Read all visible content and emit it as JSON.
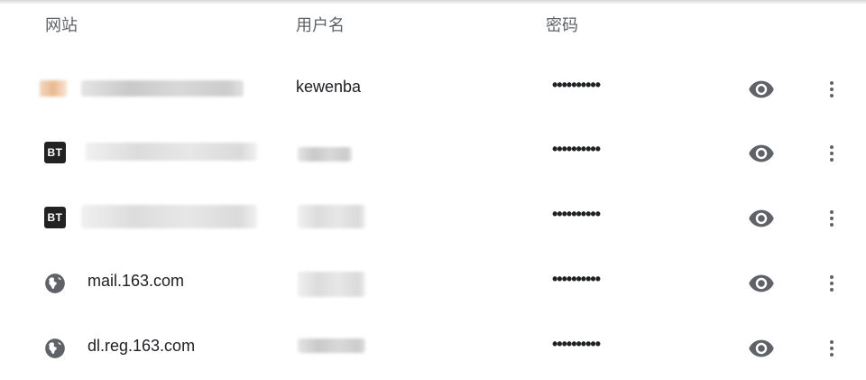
{
  "header": {
    "site": "网站",
    "username": "用户名",
    "password": "密码"
  },
  "rows": [
    {
      "site": "",
      "favicon": "blurred-favicon",
      "username": "kewenba",
      "password": "••••••••••"
    },
    {
      "site": "",
      "favicon": "BT",
      "username": "",
      "password": "••••••••••"
    },
    {
      "site": "",
      "favicon": "BT",
      "username": "",
      "password": "••••••••••"
    },
    {
      "site": "mail.163.com",
      "favicon": "globe-icon",
      "username": "",
      "password": "••••••••••"
    },
    {
      "site": "dl.reg.163.com",
      "favicon": "globe-icon",
      "username": "",
      "password": "••••••••••"
    }
  ],
  "icons": {
    "show_password": "eye-icon",
    "more_actions": "more-vert-icon"
  },
  "colors": {
    "header_text": "#5f6368",
    "text": "#202124",
    "icon": "#5f6368"
  }
}
